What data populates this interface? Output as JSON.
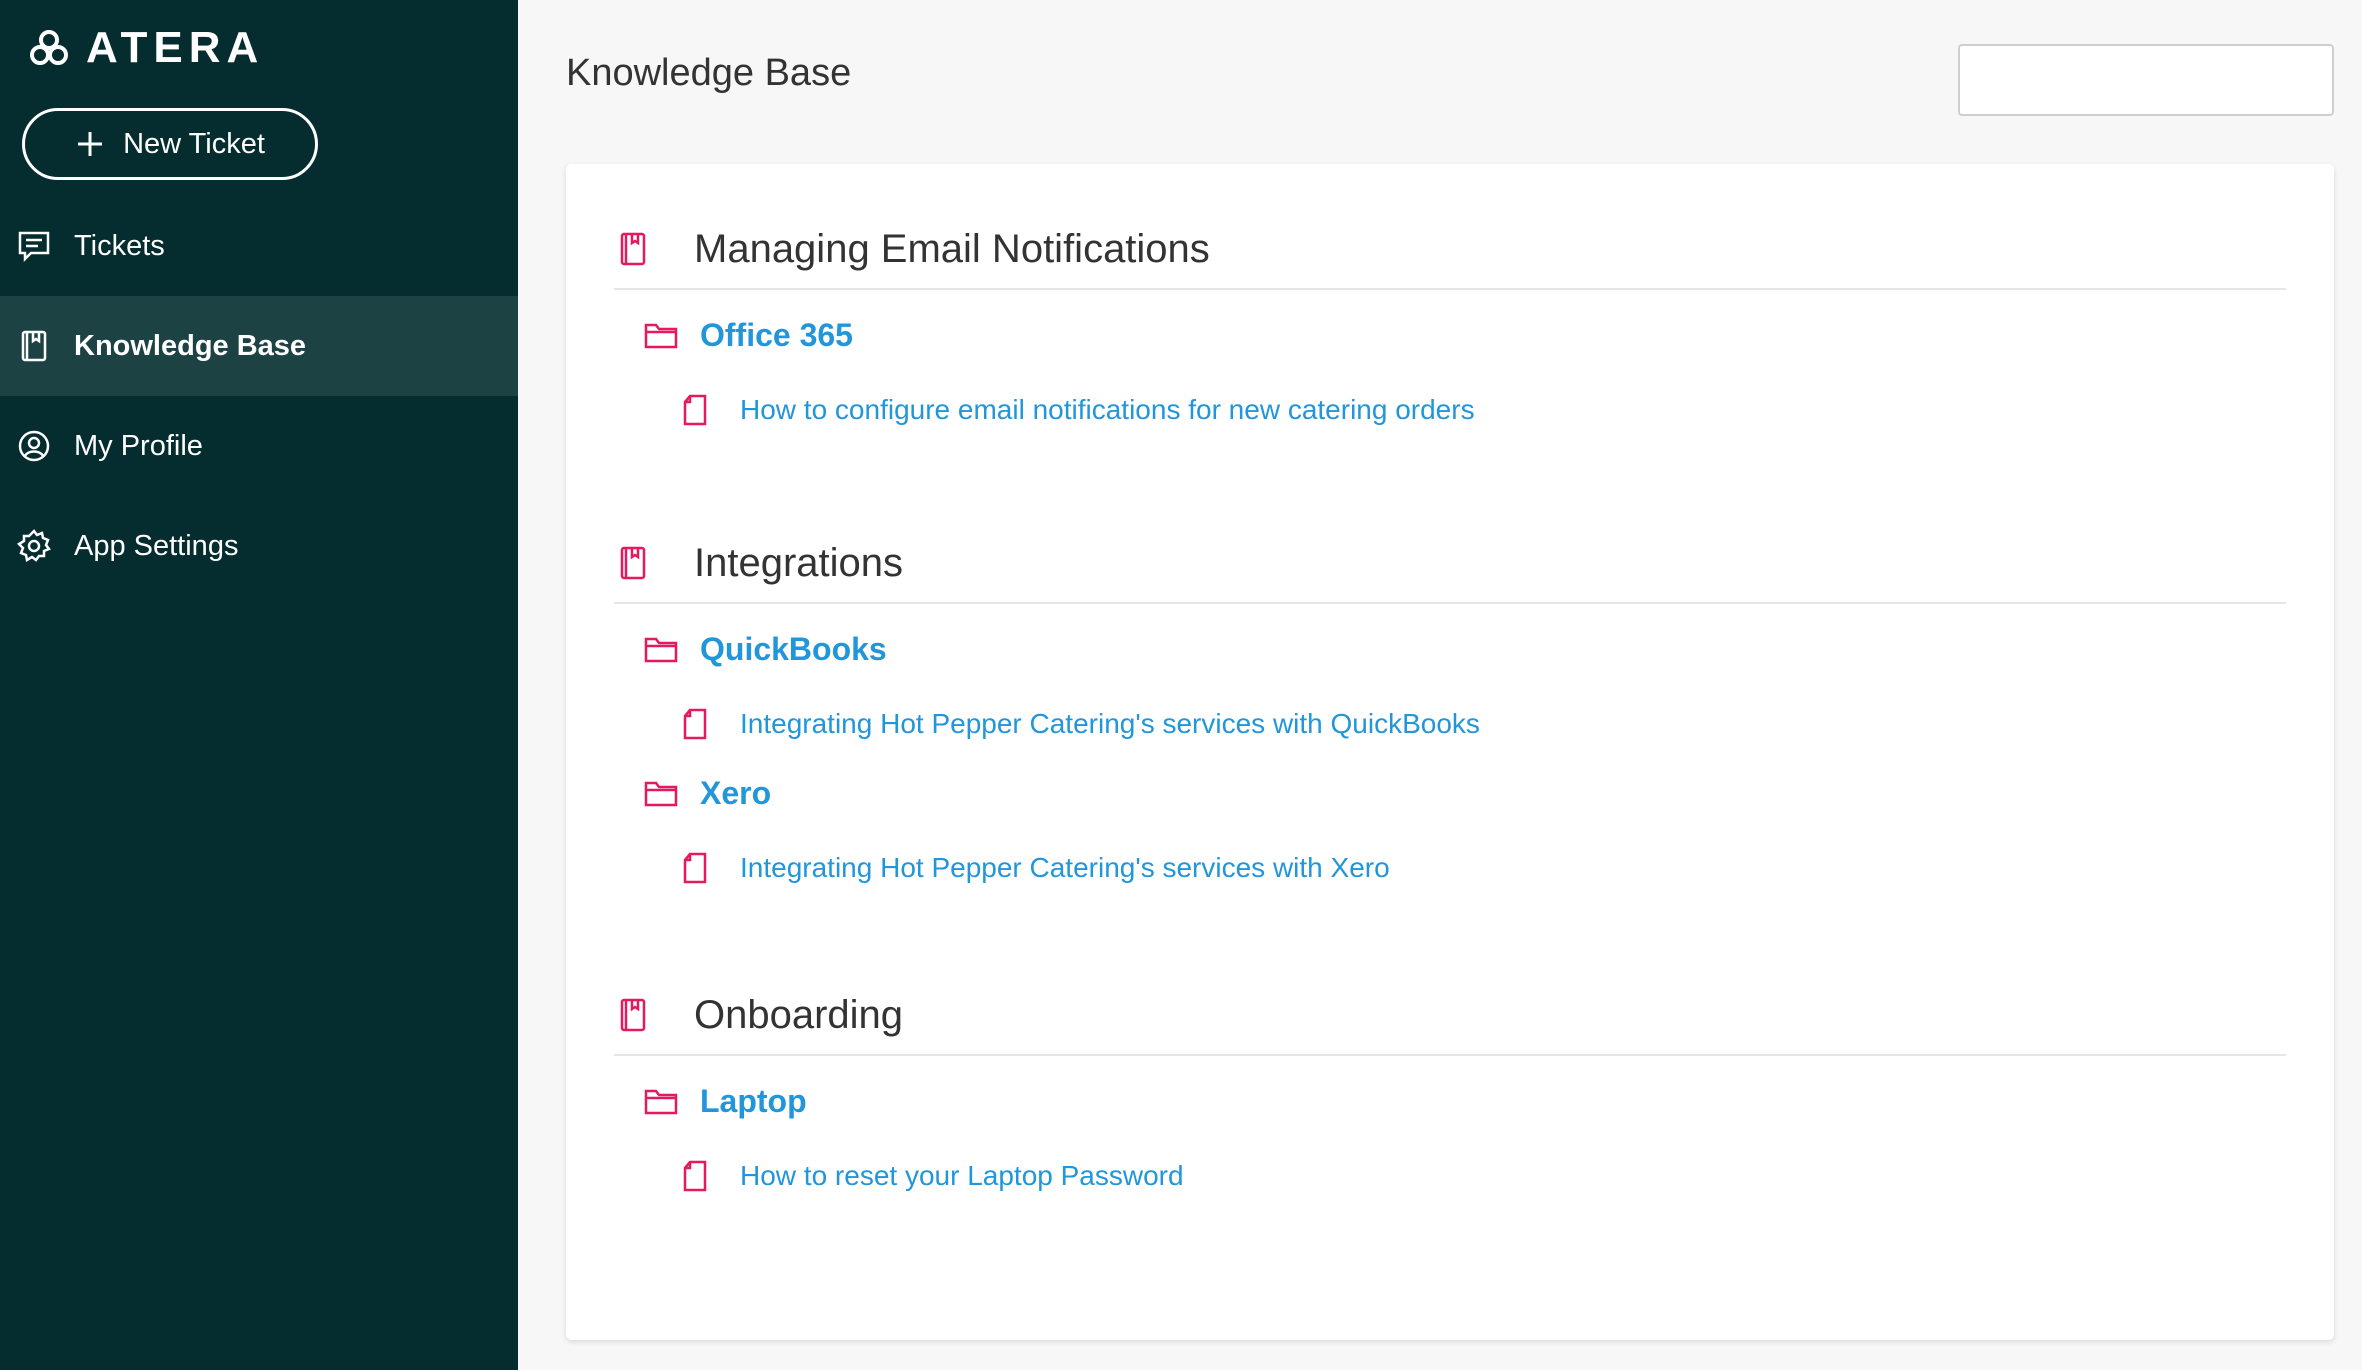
{
  "app": {
    "brand": "ATERA"
  },
  "sidebar": {
    "new_ticket_label": "New Ticket",
    "items": [
      {
        "label": "Tickets",
        "icon": "chat-icon",
        "active": false
      },
      {
        "label": "Knowledge Base",
        "icon": "notebook-icon",
        "active": true
      },
      {
        "label": "My Profile",
        "icon": "user-circle-icon",
        "active": false
      },
      {
        "label": "App Settings",
        "icon": "gear-icon",
        "active": false
      }
    ]
  },
  "header": {
    "title": "Knowledge Base",
    "search_placeholder": ""
  },
  "knowledge_base": {
    "categories": [
      {
        "title": "Managing Email Notifications",
        "folders": [
          {
            "title": "Office 365",
            "articles": [
              "How to configure email notifications for new catering orders"
            ]
          }
        ]
      },
      {
        "title": "Integrations",
        "folders": [
          {
            "title": "QuickBooks",
            "articles": [
              "Integrating Hot Pepper Catering's services with QuickBooks"
            ]
          },
          {
            "title": "Xero",
            "articles": [
              "Integrating Hot Pepper Catering's services with Xero"
            ]
          }
        ]
      },
      {
        "title": "Onboarding",
        "folders": [
          {
            "title": "Laptop",
            "articles": [
              "How to reset your Laptop Password"
            ]
          }
        ]
      }
    ]
  },
  "colors": {
    "sidebar_bg": "#052c2e",
    "sidebar_active_bg": "#1d4244",
    "link_blue": "#2196db",
    "icon_pink": "#e5195f"
  }
}
